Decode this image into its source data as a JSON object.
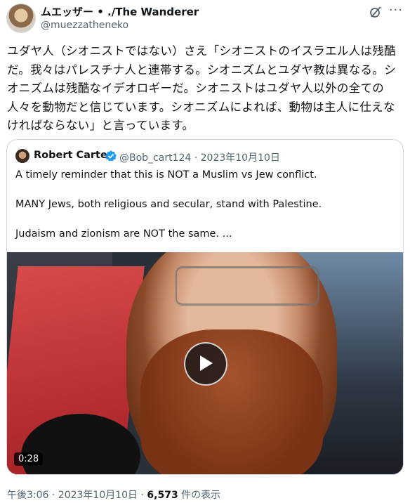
{
  "tweet": {
    "author_name": "ムエッザー • ./The Wanderer",
    "author_handle": "@muezzatheneko",
    "more_label": "···",
    "text": "ユダヤ人（シオニストではない）さえ「シオニストのイスラエル人は残酷だ。我々はパレスチナ人と連帯する。シオニズムとユダヤ教は異なる。シオニズムは残酷なイデオロギーだ。シオニストはユダヤ人以外の全ての人々を動物だと信じています。シオニズムによれば、動物は主人に仕えなければならない」と言っています。"
  },
  "quote": {
    "author_name": "Robert Carter",
    "handle_date": "@Bob_cart124 · 2023年10月10日",
    "text": "A timely reminder that this is NOT a Muslim vs Jew conflict.\n\nMANY Jews, both religious and secular, stand with Palestine.\n\nJudaism and zionism are NOT the same. ...",
    "video_duration": "0:28"
  },
  "meta": {
    "time_date": "午後3:06 · 2023年10月10日 · ",
    "views_count": "6,573",
    "views_label": " 件の表示"
  },
  "colors": {
    "accent": "#1d9bf0",
    "secondary_text": "#536471",
    "border": "#cfd9de"
  },
  "icons": [
    "grok-icon",
    "more-icon",
    "verified-icon",
    "play-icon"
  ]
}
